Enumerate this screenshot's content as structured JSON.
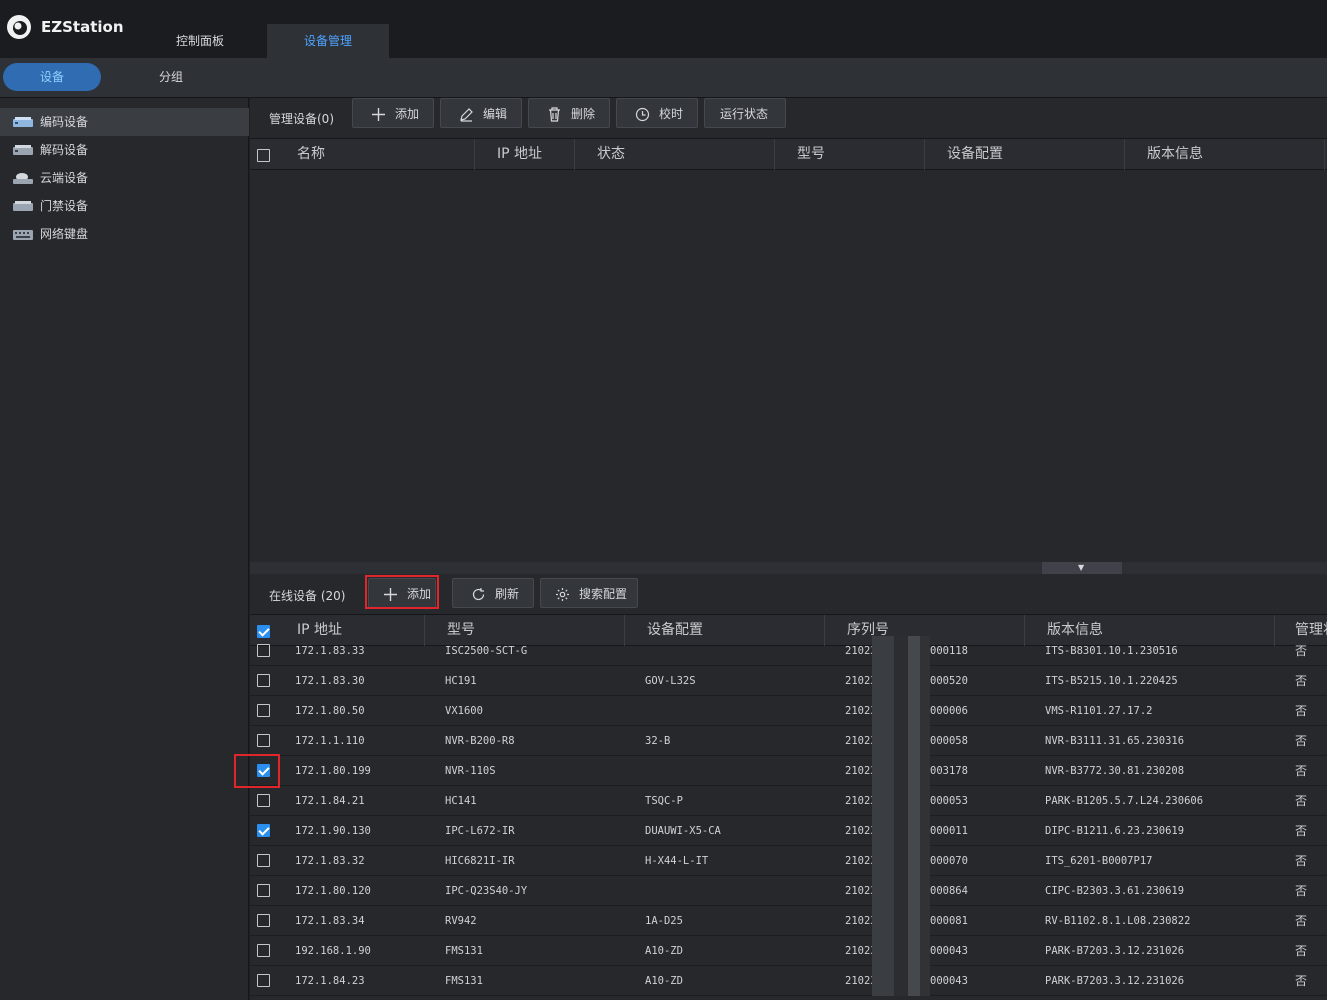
{
  "app": {
    "title": "EZStation"
  },
  "tabs": [
    {
      "label": "控制面板",
      "active": false
    },
    {
      "label": "设备管理",
      "active": true
    }
  ],
  "subtabs": [
    {
      "label": "设备",
      "active": true
    },
    {
      "label": "分组",
      "active": false
    }
  ],
  "sidebar": {
    "items": [
      {
        "label": "编码设备",
        "icon": "encoder-device-icon",
        "active": true
      },
      {
        "label": "解码设备",
        "icon": "decoder-device-icon",
        "active": false
      },
      {
        "label": "云端设备",
        "icon": "cloud-device-icon",
        "active": false
      },
      {
        "label": "门禁设备",
        "icon": "access-control-device-icon",
        "active": false
      },
      {
        "label": "网络键盘",
        "icon": "network-keyboard-icon",
        "active": false
      }
    ]
  },
  "managed": {
    "label": "管理设备(0)",
    "buttons": {
      "add": "添加",
      "edit": "编辑",
      "delete": "删除",
      "timesync": "校时",
      "status": "运行状态"
    },
    "columns": [
      "名称",
      "IP 地址",
      "状态",
      "型号",
      "设备配置",
      "版本信息"
    ]
  },
  "online": {
    "label": "在线设备 (20)",
    "buttons": {
      "add": "添加",
      "refresh": "刷新",
      "search_config": "搜索配置"
    },
    "columns": [
      "IP 地址",
      "型号",
      "设备配置",
      "序列号",
      "版本信息",
      "管理状"
    ],
    "rows": [
      {
        "ip": "172.1.83.33",
        "model": "ISC2500-SCT-G",
        "config": "",
        "serial_prefix": "21023",
        "serial_suffix": "000118",
        "version": "ITS-B8301.10.1.230516",
        "managed": "否",
        "checked": false
      },
      {
        "ip": "172.1.83.30",
        "model": "HC191",
        "config": "GOV-L32S",
        "serial_prefix": "21023",
        "serial_suffix": "000520",
        "version": "ITS-B5215.10.1.220425",
        "managed": "否",
        "checked": false
      },
      {
        "ip": "172.1.80.50",
        "model": "VX1600",
        "config": "",
        "serial_prefix": "21023",
        "serial_suffix": "000006",
        "version": "VMS-R1101.27.17.2",
        "managed": "否",
        "checked": false
      },
      {
        "ip": "172.1.1.110",
        "model": "NVR-B200-R8",
        "config": "32-B",
        "serial_prefix": "21023",
        "serial_suffix": "000058",
        "version": "NVR-B3111.31.65.230316",
        "managed": "否",
        "checked": false
      },
      {
        "ip": "172.1.80.199",
        "model": "NVR-110S",
        "config": "",
        "serial_prefix": "21023",
        "serial_suffix": "003178",
        "version": "NVR-B3772.30.81.230208",
        "managed": "否",
        "checked": true
      },
      {
        "ip": "172.1.84.21",
        "model": "HC141",
        "config": "TSQC-P",
        "serial_prefix": "21023",
        "serial_suffix": "000053",
        "version": "PARK-B1205.5.7.L24.230606",
        "managed": "否",
        "checked": false
      },
      {
        "ip": "172.1.90.130",
        "model": "IPC-L672-IR",
        "config": "DUAUWI-X5-CA",
        "serial_prefix": "21023",
        "serial_suffix": "000011",
        "version": "DIPC-B1211.6.23.230619",
        "managed": "否",
        "checked": true
      },
      {
        "ip": "172.1.83.32",
        "model": "HIC6821I-IR",
        "config": "H-X44-L-IT",
        "serial_prefix": "21023",
        "serial_suffix": "000070",
        "version": "ITS_6201-B0007P17",
        "managed": "否",
        "checked": false
      },
      {
        "ip": "172.1.80.120",
        "model": "IPC-Q23S40-JY",
        "config": "",
        "serial_prefix": "21023",
        "serial_suffix": "000864",
        "version": "CIPC-B2303.3.61.230619",
        "managed": "否",
        "checked": false
      },
      {
        "ip": "172.1.83.34",
        "model": "RV942",
        "config": "1A-D25",
        "serial_prefix": "21023",
        "serial_suffix": "000081",
        "version": "RV-B1102.8.1.L08.230822",
        "managed": "否",
        "checked": false
      },
      {
        "ip": "192.168.1.90",
        "model": "FMS131",
        "config": "A10-ZD",
        "serial_prefix": "21023",
        "serial_suffix": "000043",
        "version": "PARK-B7203.3.12.231026",
        "managed": "否",
        "checked": false
      },
      {
        "ip": "172.1.84.23",
        "model": "FMS131",
        "config": "A10-ZD",
        "serial_prefix": "21023",
        "serial_suffix": "000043",
        "version": "PARK-B7203.3.12.231026",
        "managed": "否",
        "checked": false
      }
    ]
  },
  "colors": {
    "accent": "#2a8fee",
    "active_tab_text": "#4ea3ff",
    "highlight": "#e0252b"
  }
}
